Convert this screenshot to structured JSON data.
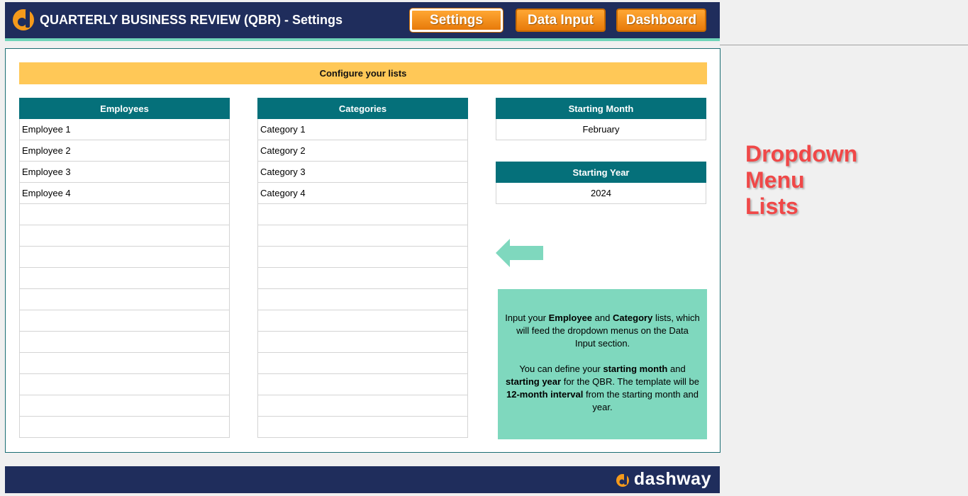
{
  "header": {
    "title": "QUARTERLY BUSINESS REVIEW (QBR) - Settings",
    "nav": {
      "settings": "Settings",
      "data_input": "Data Input",
      "dashboard": "Dashboard"
    }
  },
  "main": {
    "configure_title": "Configure your lists",
    "employees": {
      "header": "Employees",
      "items": [
        "Employee 1",
        "Employee 2",
        "Employee 3",
        "Employee 4",
        "",
        "",
        "",
        "",
        "",
        "",
        "",
        "",
        "",
        "",
        ""
      ]
    },
    "categories": {
      "header": "Categories",
      "items": [
        "Category 1",
        "Category 2",
        "Category 3",
        "Category 4",
        "",
        "",
        "",
        "",
        "",
        "",
        "",
        "",
        "",
        "",
        ""
      ]
    },
    "starting_month": {
      "header": "Starting Month",
      "value": "February"
    },
    "starting_year": {
      "header": "Starting Year",
      "value": "2024"
    },
    "note": {
      "p1_a": "Input your ",
      "p1_b": "Employee",
      "p1_c": " and ",
      "p1_d": "Category",
      "p1_e": " lists, which will feed the dropdown menus on the Data Input section.",
      "p2_a": "You can define your ",
      "p2_b": "starting month",
      "p2_c": " and ",
      "p2_d": "starting year",
      "p2_e": " for the  QBR. The template will be ",
      "p2_f": "12-month interval",
      "p2_g": " from the starting month and year."
    }
  },
  "side_label": [
    "Dropdown",
    "Menu",
    "Lists"
  ],
  "footer": {
    "brand": "dashway"
  },
  "colors": {
    "navy": "#1f2d5c",
    "teal": "#05707a",
    "mint": "#7fd8be",
    "orange": "#f28c12",
    "yellow": "#ffc857",
    "label_red": "#f04848"
  }
}
